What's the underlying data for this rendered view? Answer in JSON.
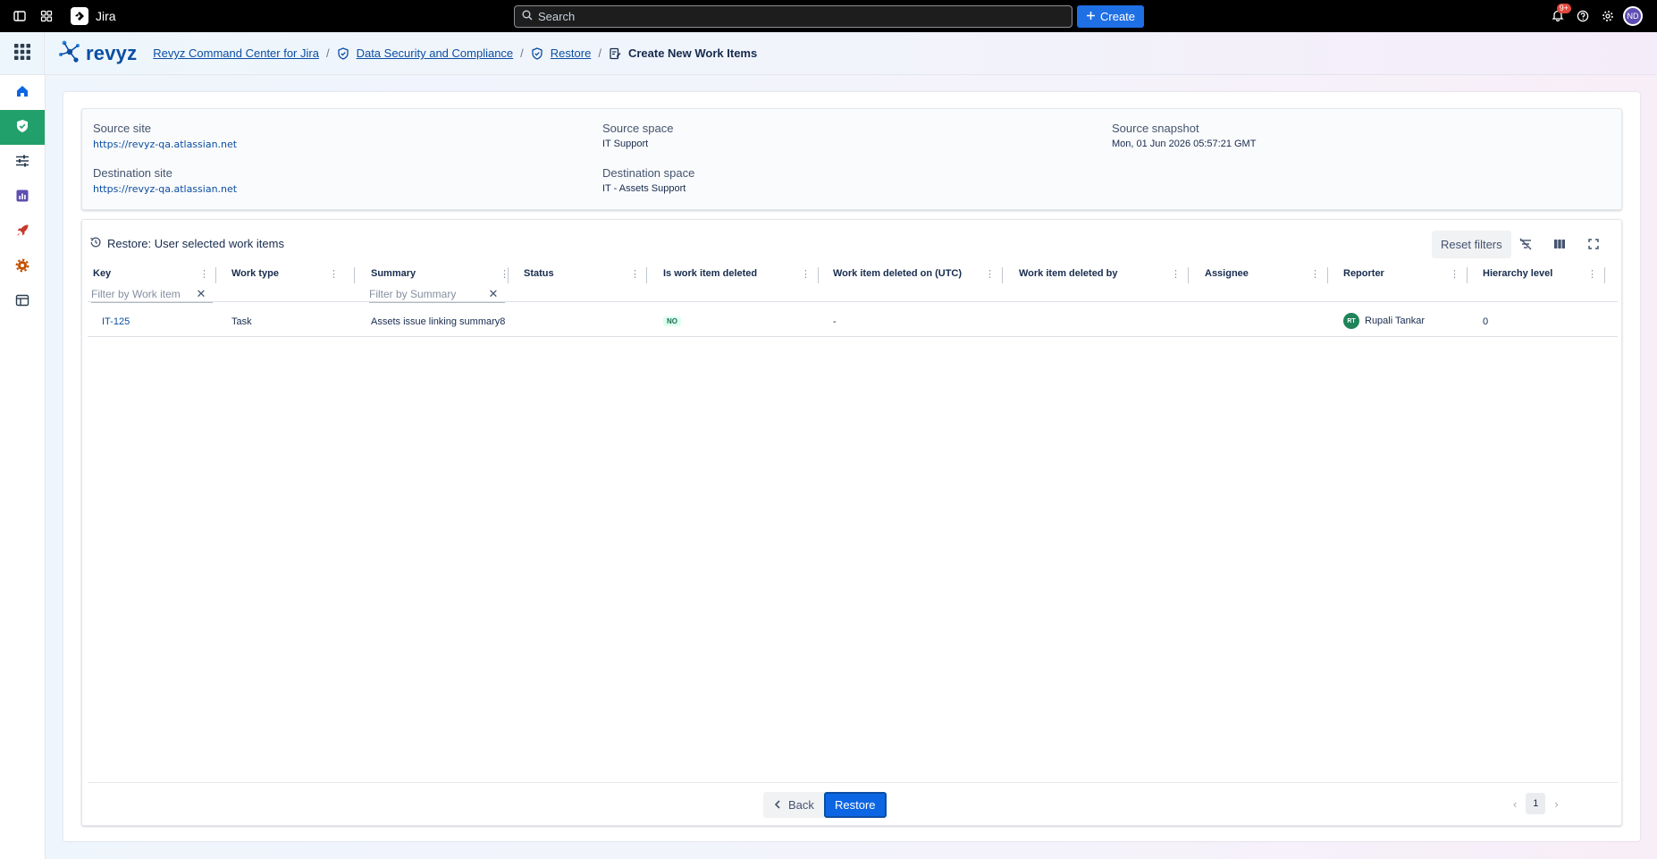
{
  "topbar": {
    "app_name": "Jira",
    "search_placeholder": "Search",
    "create_label": "Create",
    "notification_count": "9+",
    "user_initials": "ND"
  },
  "header": {
    "brand": "revyz",
    "breadcrumbs": [
      "Revyz Command Center for Jira",
      "Data Security and Compliance",
      "Restore",
      "Create New Work Items"
    ]
  },
  "info": {
    "source_site_label": "Source site",
    "source_site": "https://revyz-qa.atlassian.net",
    "source_space_label": "Source space",
    "source_space": "IT Support",
    "source_snapshot_label": "Source snapshot",
    "source_snapshot": "Mon, 01 Jun 2026 05:57:21 GMT",
    "destination_site_label": "Destination site",
    "destination_site": "https://revyz-qa.atlassian.net",
    "destination_space_label": "Destination space",
    "destination_space": "IT - Assets Support"
  },
  "table": {
    "title": "Restore: User selected work items",
    "reset_filters_label": "Reset filters",
    "columns": [
      "Key",
      "Work type",
      "Summary",
      "Status",
      "Is work item deleted",
      "Work item deleted on (UTC)",
      "Work item deleted by",
      "Assignee",
      "Reporter",
      "Hierarchy level"
    ],
    "filter_key_placeholder": "Filter by Work item",
    "filter_summary_placeholder": "Filter by Summary",
    "rows": [
      {
        "key": "IT-125",
        "work_type": "Task",
        "summary": "Assets issue linking summary8",
        "status": "",
        "is_deleted": "NO",
        "deleted_on": "-",
        "deleted_by": "",
        "assignee": "",
        "reporter_initials": "RT",
        "reporter": "Rupali Tankar",
        "hierarchy_level": "0"
      }
    ]
  },
  "footer": {
    "back_label": "Back",
    "restore_label": "Restore",
    "current_page": "1"
  },
  "colors": {
    "brand_blue": "#0b4ea2",
    "primary_button": "#0c66e4",
    "active_nav": "#22a06b"
  }
}
